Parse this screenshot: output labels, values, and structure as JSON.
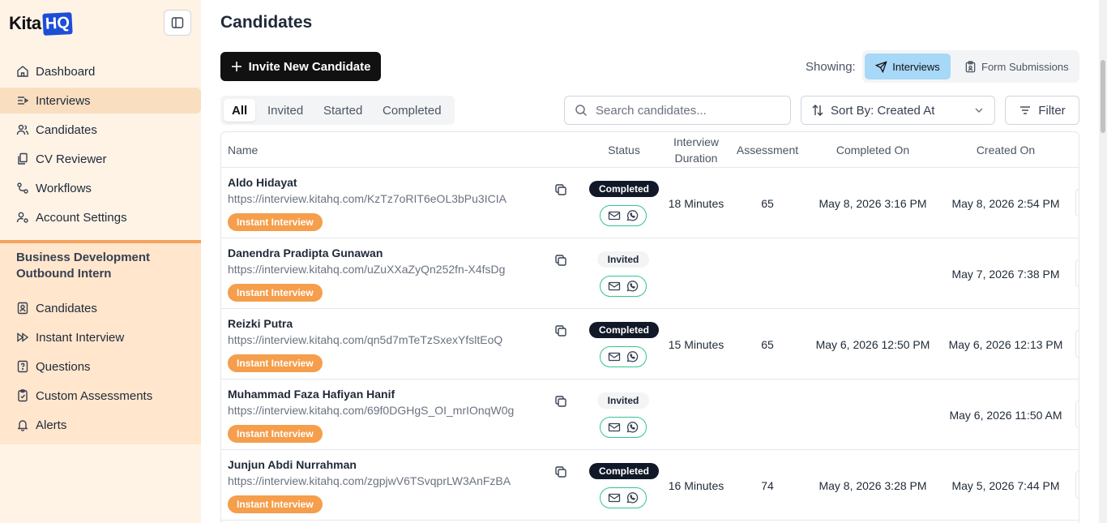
{
  "logo": {
    "text1": "Kita",
    "text2": "HQ"
  },
  "nav": [
    {
      "label": "Dashboard",
      "icon": "home-icon",
      "active": false
    },
    {
      "label": "Interviews",
      "icon": "interviews-icon",
      "active": true
    },
    {
      "label": "Candidates",
      "icon": "users-icon",
      "active": false
    },
    {
      "label": "CV Reviewer",
      "icon": "documents-icon",
      "active": false
    },
    {
      "label": "Workflows",
      "icon": "workflow-icon",
      "active": false
    },
    {
      "label": "Account Settings",
      "icon": "user-settings-icon",
      "active": false
    }
  ],
  "section": {
    "title": "Business Development Outbound Intern",
    "items": [
      {
        "label": "Candidates",
        "icon": "id-card-icon"
      },
      {
        "label": "Instant Interview",
        "icon": "fast-forward-icon"
      },
      {
        "label": "Questions",
        "icon": "question-file-icon"
      },
      {
        "label": "Custom Assessments",
        "icon": "assessment-icon"
      },
      {
        "label": "Alerts",
        "icon": "bell-icon"
      }
    ]
  },
  "page": {
    "title": "Candidates"
  },
  "toolbar": {
    "invite_label": "Invite New Candidate",
    "showing_label": "Showing:",
    "view_interviews": "Interviews",
    "view_forms": "Form Submissions"
  },
  "tabs": [
    "All",
    "Invited",
    "Started",
    "Completed"
  ],
  "search": {
    "placeholder": "Search candidates..."
  },
  "sort": {
    "label": "Sort By: Created At"
  },
  "filter": {
    "label": "Filter"
  },
  "table": {
    "headers": {
      "name": "Name",
      "status": "Status",
      "duration": "Interview Duration",
      "assessment": "Assessment",
      "completed_on": "Completed On",
      "created_on": "Created On"
    },
    "rows": [
      {
        "name": "Aldo Hidayat",
        "link": "https://interview.kitahq.com/KzTz7oRIT6eOL3bPu3ICIA",
        "badge": "Instant Interview",
        "status": "Completed",
        "duration": "18 Minutes",
        "assessment": "65",
        "completed_on": "May 8, 2026 3:16 PM",
        "created_on": "May 8, 2026 2:54 PM"
      },
      {
        "name": "Danendra Pradipta Gunawan",
        "link": "https://interview.kitahq.com/uZuXXaZyQn252fn-X4fsDg",
        "badge": "Instant Interview",
        "status": "Invited",
        "duration": "",
        "assessment": "",
        "completed_on": "",
        "created_on": "May 7, 2026 7:38 PM"
      },
      {
        "name": "Reizki Putra",
        "link": "https://interview.kitahq.com/qn5d7mTeTzSxexYfsltEoQ",
        "badge": "Instant Interview",
        "status": "Completed",
        "duration": "15 Minutes",
        "assessment": "65",
        "completed_on": "May 6, 2026 12:50 PM",
        "created_on": "May 6, 2026 12:13 PM"
      },
      {
        "name": "Muhammad Faza Hafiyan Hanif",
        "link": "https://interview.kitahq.com/69f0DGHgS_OI_mrIOnqW0g",
        "badge": "Instant Interview",
        "status": "Invited",
        "duration": "",
        "assessment": "",
        "completed_on": "",
        "created_on": "May 6, 2026 11:50 AM"
      },
      {
        "name": "Junjun Abdi Nurrahman",
        "link": "https://interview.kitahq.com/zgpjwV6TSvqprLW3AnFzBA",
        "badge": "Instant Interview",
        "status": "Completed",
        "duration": "16 Minutes",
        "assessment": "74",
        "completed_on": "May 8, 2026 3:28 PM",
        "created_on": "May 5, 2026 7:44 PM"
      }
    ]
  },
  "colors": {
    "accent": "#f59e4c",
    "sidebar_bg": "#fff3e6",
    "active_nav": "#f9dfc0",
    "view_active": "#a7d8f7",
    "contact_border": "#34c38f"
  }
}
